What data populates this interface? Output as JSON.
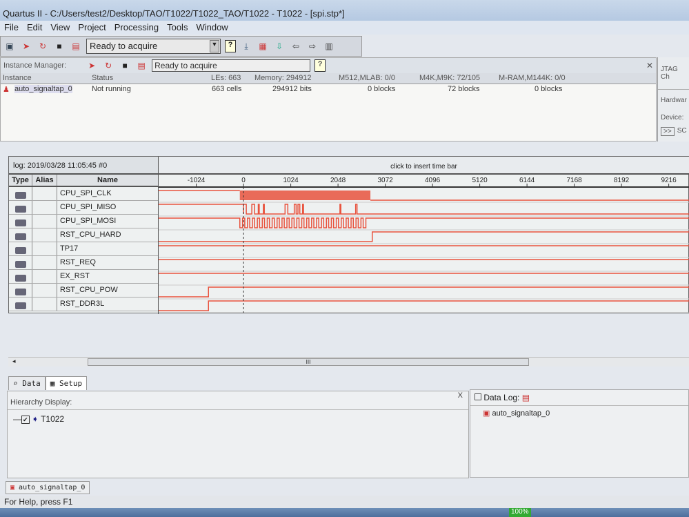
{
  "window": {
    "title": "Quartus II - C:/Users/test2/Desktop/TAO/T1022/T1022_TAO/T1022 - T1022 - [spi.stp*]"
  },
  "menu": [
    "File",
    "Edit",
    "View",
    "Project",
    "Processing",
    "Tools",
    "Window"
  ],
  "toolbar": {
    "status": "Ready to acquire"
  },
  "instance_manager": {
    "label": "Instance Manager:",
    "status": "Ready to acquire",
    "headers": [
      "Instance",
      "Status",
      "LEs: 663",
      "Memory: 294912",
      "M512,MLAB: 0/0",
      "M4K,M9K: 72/105",
      "M-RAM,M144K: 0/0"
    ],
    "row": [
      "auto_signaltap_0",
      "Not running",
      "663 cells",
      "294912 bits",
      "0 blocks",
      "72 blocks",
      "0 blocks"
    ]
  },
  "jtag": {
    "title": "JTAG Ch",
    "hardware": "Hardwar",
    "device": "Device:",
    "btn": ">>",
    "sc": "SC"
  },
  "waveform": {
    "log": "log: 2019/03/28 11:05:45  #0",
    "hint": "click to insert time bar",
    "columns": [
      "Type",
      "Alias",
      "Name"
    ],
    "ticks": [
      "-1024",
      "0",
      "1024",
      "2048",
      "3072",
      "4096",
      "5120",
      "6144",
      "7168",
      "8192",
      "9216"
    ],
    "signals": [
      {
        "name": "CPU_SPI_CLK",
        "type": "input",
        "initial": 1,
        "edges": [
          -80
        ],
        "burst": [
          -80,
          2750,
          24,
          "fill"
        ],
        "final": 0
      },
      {
        "name": "CPU_SPI_MISO",
        "type": "input",
        "initial": 1,
        "pulses": [
          [
            0,
            60
          ],
          [
            180,
            240
          ],
          [
            320,
            340
          ],
          [
            430,
            450
          ],
          [
            900,
            960
          ],
          [
            1100,
            1140
          ],
          [
            1180,
            1220
          ],
          [
            1280,
            1300
          ],
          [
            2090,
            2110
          ],
          [
            2430,
            2460
          ]
        ],
        "final": 0
      },
      {
        "name": "CPU_SPI_MOSI",
        "type": "input",
        "initial": 1,
        "burst": [
          -80,
          2700,
          26,
          "square"
        ],
        "final": 1
      },
      {
        "name": "RST_CPU_HARD",
        "type": "input",
        "initial": 0,
        "edges": [
          2790
        ]
      },
      {
        "name": "TP17",
        "type": "input",
        "initial": 1,
        "edges": []
      },
      {
        "name": "RST_REQ",
        "type": "input",
        "initial": 1,
        "edges": []
      },
      {
        "name": "EX_RST",
        "type": "input",
        "initial": 1,
        "edges": []
      },
      {
        "name": "RST_CPU_POW",
        "type": "output",
        "initial": 0,
        "edges": [
          -760
        ]
      },
      {
        "name": "RST_DDR3L",
        "type": "output",
        "initial": 0,
        "edges": [
          -760
        ]
      }
    ],
    "range": [
      -1840,
      9670
    ],
    "trigger": 0,
    "color": "#e8533e"
  },
  "scroll": {
    "thumb": "III"
  },
  "tabs": [
    "Data",
    "Setup"
  ],
  "hierarchy": {
    "label": "Hierarchy Display:",
    "item": "T1022",
    "close": "X"
  },
  "datalog": {
    "label": "Data Log:",
    "item": "auto_signaltap_0"
  },
  "bottom_tab": "auto_signaltap_0",
  "statusbar": "For Help, press F1",
  "battery": "100%"
}
